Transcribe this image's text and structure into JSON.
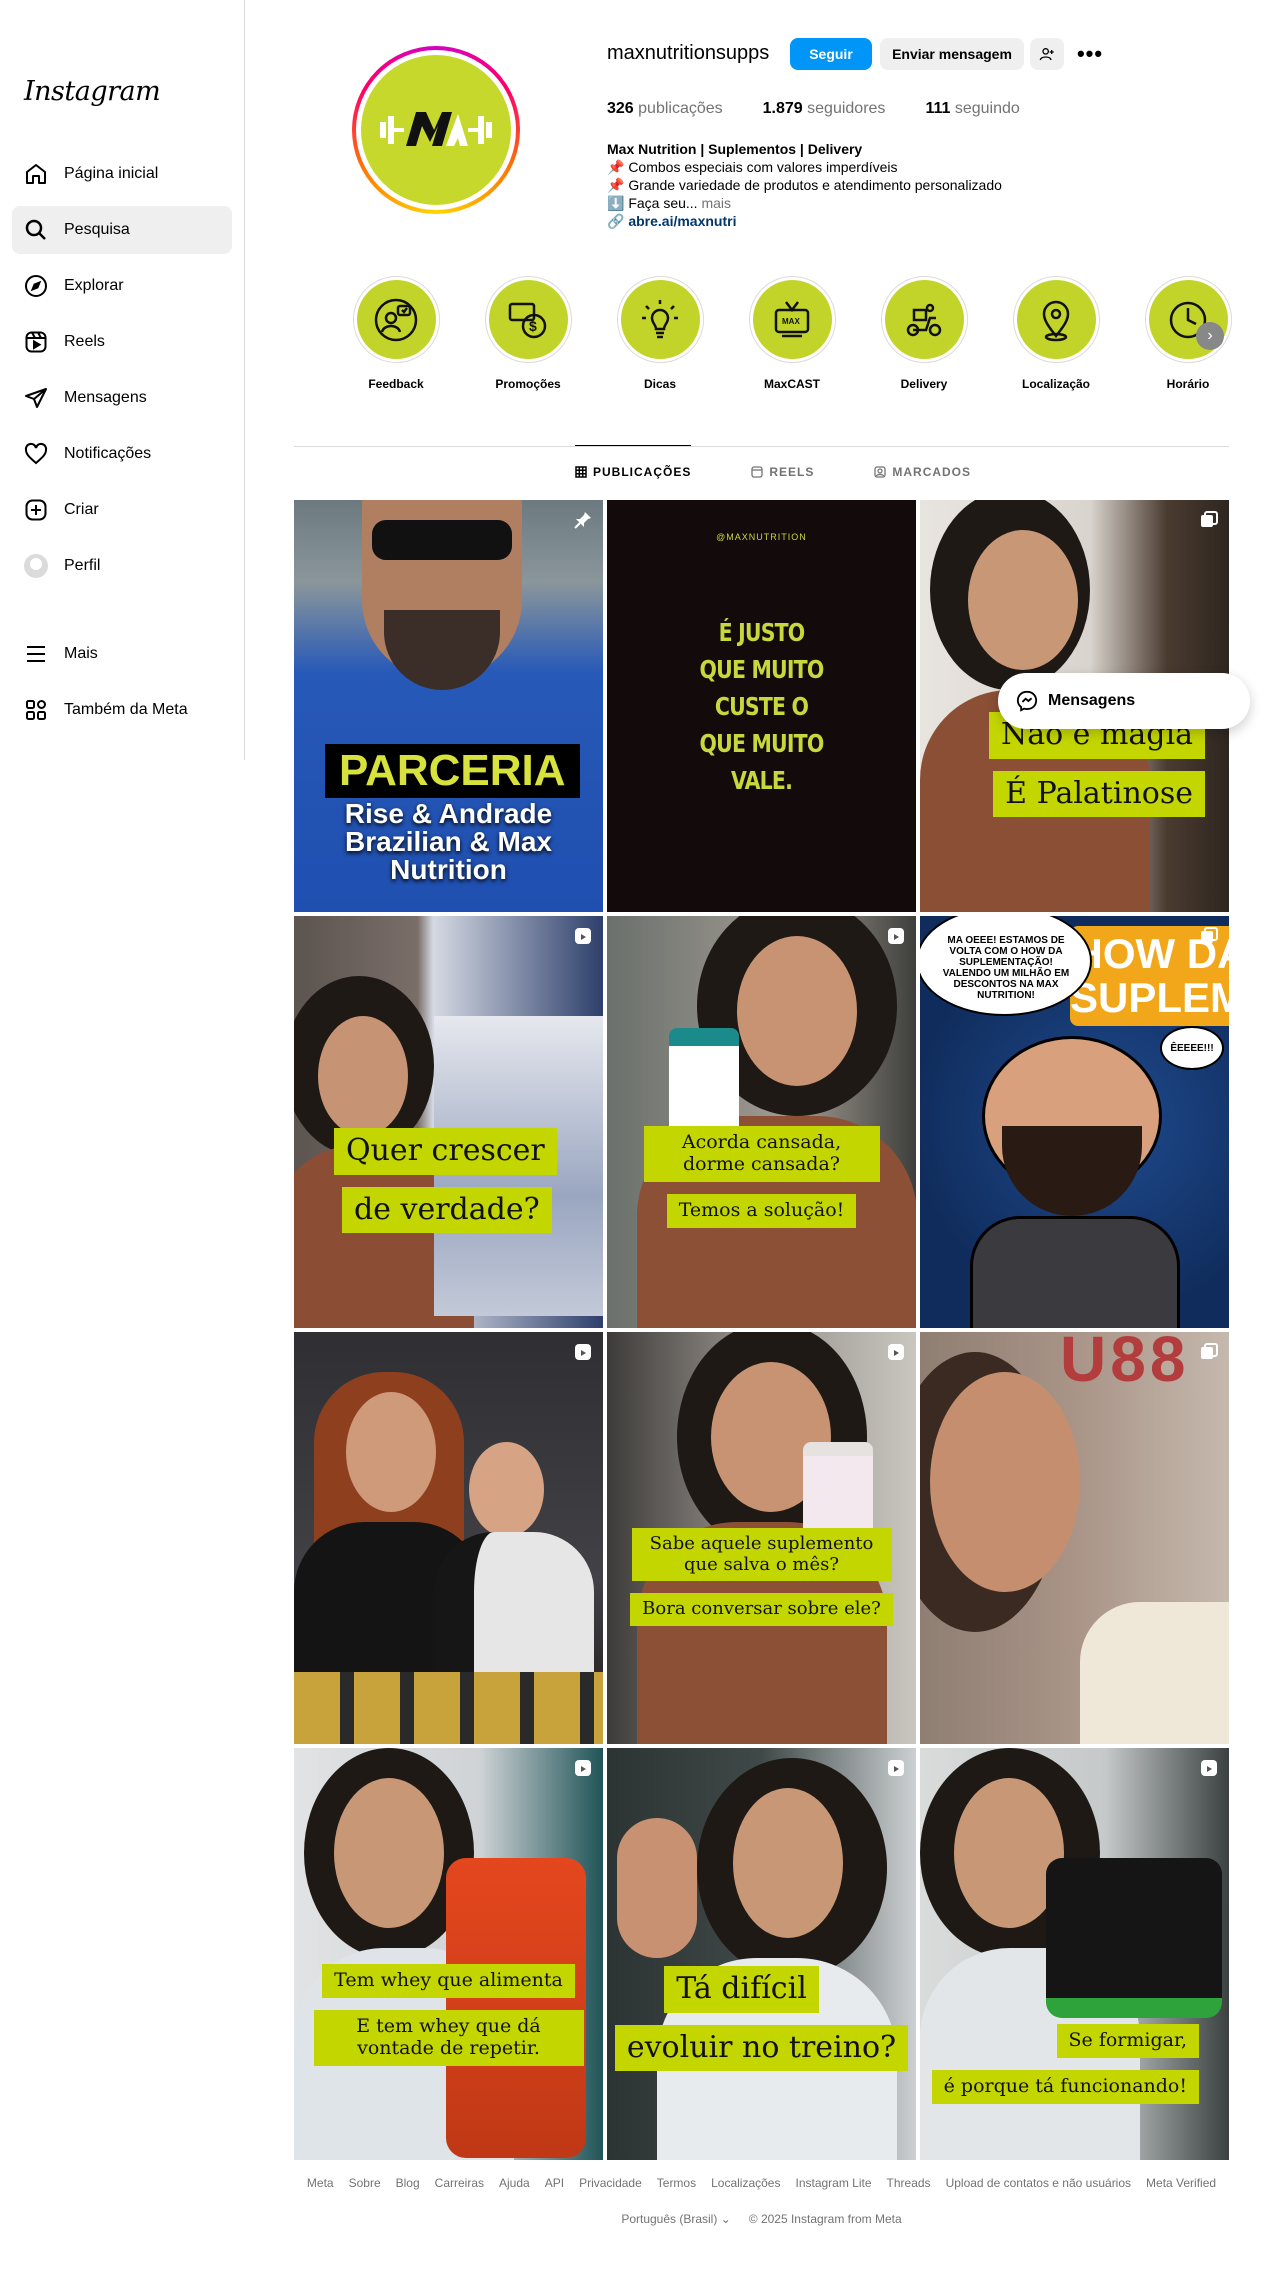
{
  "app": {
    "logo": "Instagram"
  },
  "sidebar": {
    "items": [
      {
        "label": "Página inicial",
        "icon": "home-icon"
      },
      {
        "label": "Pesquisa",
        "icon": "search-icon",
        "active": true
      },
      {
        "label": "Explorar",
        "icon": "compass-icon"
      },
      {
        "label": "Reels",
        "icon": "reels-icon"
      },
      {
        "label": "Mensagens",
        "icon": "messenger-icon"
      },
      {
        "label": "Notificações",
        "icon": "heart-icon"
      },
      {
        "label": "Criar",
        "icon": "plus-square-icon"
      },
      {
        "label": "Perfil",
        "icon": "avatar"
      }
    ],
    "more_label": "Mais",
    "meta_label": "Também da Meta"
  },
  "profile": {
    "username": "maxnutritionsupps",
    "follow_label": "Seguir",
    "message_label": "Enviar mensagem",
    "posts_count": "326",
    "posts_label": "publicações",
    "followers_count": "1.879",
    "followers_label": "seguidores",
    "following_count": "111",
    "following_label": "seguindo",
    "bio_name": "Max Nutrition | Suplementos | Delivery",
    "bio_lines": [
      "📌 Combos especiais com valores imperdíveis",
      "📌 Grande variedade de produtos e atendimento personalizado",
      "⬇️ Faça seu..."
    ],
    "bio_more": "mais",
    "link": "abre.ai/maxnutri"
  },
  "highlights": [
    {
      "label": "Feedback",
      "icon": "feedback-icon"
    },
    {
      "label": "Promoções",
      "icon": "money-icon"
    },
    {
      "label": "Dicas",
      "icon": "lightbulb-icon"
    },
    {
      "label": "MaxCAST",
      "icon": "tv-icon"
    },
    {
      "label": "Delivery",
      "icon": "scooter-icon"
    },
    {
      "label": "Localização",
      "icon": "location-pin-icon"
    },
    {
      "label": "Horário",
      "icon": "clock-icon"
    }
  ],
  "tabs": [
    {
      "label": "PUBLICAÇÕES",
      "active": true
    },
    {
      "label": "REELS"
    },
    {
      "label": "MARCADOS"
    }
  ],
  "posts": {
    "p0": {
      "title": "PARCERIA",
      "sub1": "Rise & Andrade",
      "sub2": "Brazilian & Max",
      "sub3": "Nutrition",
      "type": "pinned"
    },
    "p1": {
      "brand": "@MAXNUTRITION",
      "l1": "É JUSTO",
      "l2": "QUE MUITO",
      "l3": "CUSTE O",
      "l4": "QUE MUITO",
      "l5": "VALE."
    },
    "p2": {
      "c1": "Não é magia",
      "c2": "É Palatinose",
      "type": "carousel"
    },
    "p3": {
      "c1": "Quer crescer",
      "c2": "de verdade?",
      "type": "reel"
    },
    "p4": {
      "c1": "Acorda cansada, dorme cansada?",
      "c2": "Temos a solução!",
      "type": "reel"
    },
    "p5": {
      "bubble": "MA OEEE! ESTAMOS DE VOLTA COM O HOW DA SUPLEMENTAÇÃO! VALENDO UM MILHÃO EM DESCONTOS NA MAX NUTRITION!",
      "bubble2": "ÊEEEE!!!",
      "banner": "HOW DA SUPLEMENTAÇÃO",
      "type": "carousel"
    },
    "p6": {
      "type": "reel"
    },
    "p7": {
      "c1": "Sabe aquele suplemento que salva o mês?",
      "c2": "Bora conversar sobre ele?",
      "type": "reel"
    },
    "p8": {
      "type": "carousel"
    },
    "p9": {
      "c1": "Tem whey que alimenta",
      "c2": "E tem whey que dá vontade de repetir.",
      "type": "reel"
    },
    "p10": {
      "c1": "Tá difícil",
      "c2": "evoluir no treino?",
      "type": "reel"
    },
    "p11": {
      "c1": "Se formigar,",
      "c2": "é porque tá funcionando!",
      "type": "reel"
    }
  },
  "messages_pill": {
    "label": "Mensagens"
  },
  "footer": {
    "links": [
      "Meta",
      "Sobre",
      "Blog",
      "Carreiras",
      "Ajuda",
      "API",
      "Privacidade",
      "Termos",
      "Localizações",
      "Instagram Lite",
      "Threads",
      "Upload de contatos e não usuários",
      "Meta Verified"
    ],
    "language": "Português (Brasil)",
    "copyright": "© 2025 Instagram from Meta"
  },
  "colors": {
    "accent": "#0095f6",
    "brand_lime": "#c4d600"
  }
}
